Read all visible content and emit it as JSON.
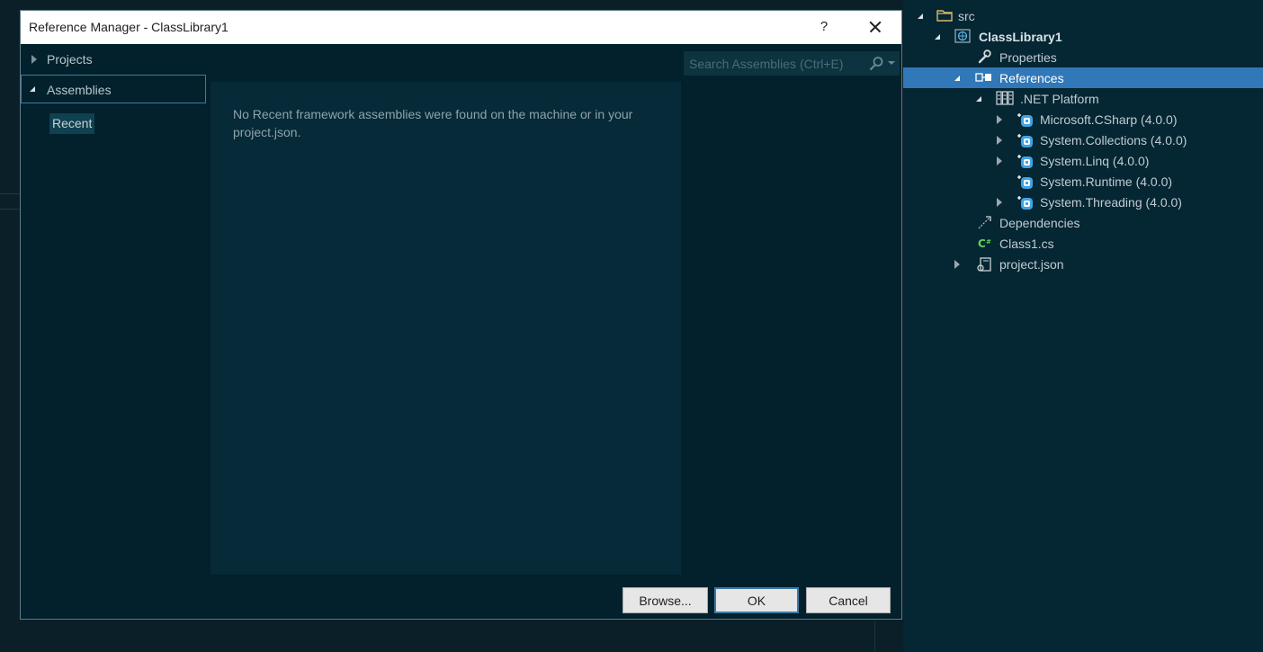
{
  "dialog": {
    "title": "Reference Manager - ClassLibrary1",
    "help_label": "?",
    "nav": {
      "projects": "Projects",
      "assemblies": "Assemblies",
      "recent": "Recent"
    },
    "search": {
      "placeholder": "Search Assemblies (Ctrl+E)",
      "value": ""
    },
    "message": "No Recent framework assemblies were found on the machine or in your project.json.",
    "buttons": {
      "browse": "Browse...",
      "ok": "OK",
      "cancel": "Cancel"
    }
  },
  "explorer": {
    "items": [
      {
        "label": "src",
        "icon": "folder-icon",
        "expand": "open"
      },
      {
        "label": "ClassLibrary1",
        "icon": "web-project-icon",
        "expand": "open"
      },
      {
        "label": "Properties",
        "icon": "wrench-icon",
        "expand": "none"
      },
      {
        "label": "References",
        "icon": "references-icon",
        "expand": "open",
        "selected": true
      },
      {
        "label": ".NET Platform",
        "icon": "library-icon",
        "expand": "open"
      },
      {
        "label": "Microsoft.CSharp (4.0.0)",
        "icon": "assembly-icon",
        "expand": "closed"
      },
      {
        "label": "System.Collections (4.0.0)",
        "icon": "assembly-icon",
        "expand": "closed"
      },
      {
        "label": "System.Linq (4.0.0)",
        "icon": "assembly-icon",
        "expand": "closed"
      },
      {
        "label": "System.Runtime (4.0.0)",
        "icon": "assembly-icon",
        "expand": "none"
      },
      {
        "label": "System.Threading (4.0.0)",
        "icon": "assembly-icon",
        "expand": "closed"
      },
      {
        "label": "Dependencies",
        "icon": "dependencies-icon",
        "expand": "none"
      },
      {
        "label": "Class1.cs",
        "icon": "csharp-file-icon",
        "expand": "none"
      },
      {
        "label": "project.json",
        "icon": "json-file-icon",
        "expand": "closed"
      }
    ]
  },
  "colors": {
    "selection": "#3178b8",
    "dialog_bg": "#02212c",
    "explorer_bg": "#052633",
    "focus_border": "#3d7aa6"
  }
}
